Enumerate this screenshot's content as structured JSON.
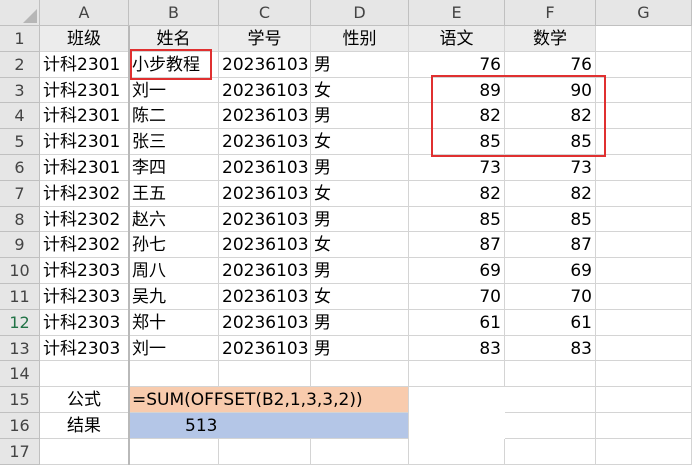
{
  "columns": [
    "A",
    "B",
    "C",
    "D",
    "E",
    "F",
    "G"
  ],
  "header_row": {
    "class": "班级",
    "name": "姓名",
    "id": "学号",
    "gender": "性别",
    "chinese": "语文",
    "math": "数学"
  },
  "students": [
    {
      "class": "计科2301",
      "name": "小步教程",
      "id": "20236103",
      "gender": "男",
      "chinese": "76",
      "math": "76"
    },
    {
      "class": "计科2301",
      "name": "刘一",
      "id": "20236103",
      "gender": "女",
      "chinese": "89",
      "math": "90"
    },
    {
      "class": "计科2301",
      "name": "陈二",
      "id": "20236103",
      "gender": "男",
      "chinese": "82",
      "math": "82"
    },
    {
      "class": "计科2301",
      "name": "张三",
      "id": "20236103",
      "gender": "女",
      "chinese": "85",
      "math": "85"
    },
    {
      "class": "计科2301",
      "name": "李四",
      "id": "20236103",
      "gender": "男",
      "chinese": "73",
      "math": "73"
    },
    {
      "class": "计科2302",
      "name": "王五",
      "id": "20236103",
      "gender": "女",
      "chinese": "82",
      "math": "82"
    },
    {
      "class": "计科2302",
      "name": "赵六",
      "id": "20236103",
      "gender": "男",
      "chinese": "85",
      "math": "85"
    },
    {
      "class": "计科2302",
      "name": "孙七",
      "id": "20236103",
      "gender": "女",
      "chinese": "87",
      "math": "87"
    },
    {
      "class": "计科2303",
      "name": "周八",
      "id": "20236103",
      "gender": "男",
      "chinese": "69",
      "math": "69"
    },
    {
      "class": "计科2303",
      "name": "吴九",
      "id": "20236103",
      "gender": "女",
      "chinese": "70",
      "math": "70"
    },
    {
      "class": "计科2303",
      "name": "郑十",
      "id": "20236103",
      "gender": "男",
      "chinese": "61",
      "math": "61"
    },
    {
      "class": "计科2303",
      "name": "刘一",
      "id": "20236103",
      "gender": "男",
      "chinese": "83",
      "math": "83"
    }
  ],
  "formula_label": "公式",
  "formula_text": "=SUM(OFFSET(B2,1,3,3,2))",
  "result_label": "结果",
  "result_value": "513",
  "colors": {
    "formula_fill": "#f8cbad",
    "result_fill": "#b4c6e7",
    "highlight_border": "#e03030",
    "selected_row_header": "#217346"
  }
}
